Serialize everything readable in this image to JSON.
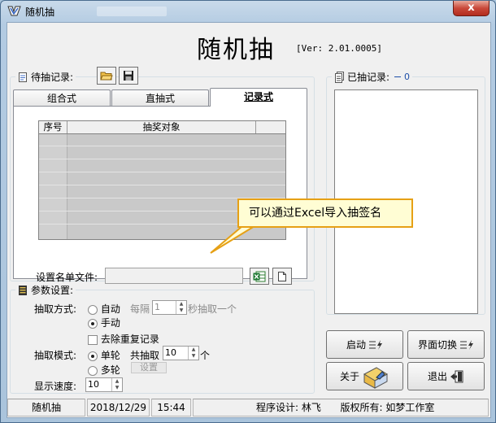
{
  "window": {
    "title": "随机抽",
    "close_glyph": "x"
  },
  "header": {
    "app_title": "随机抽",
    "version": "[Ver: 2.01.0005]"
  },
  "pending": {
    "legend": "待抽记录:",
    "tabs": [
      {
        "label": "组合式"
      },
      {
        "label": "直抽式"
      },
      {
        "label": "记录式"
      }
    ],
    "columns": [
      "序号",
      "抽奖对象"
    ],
    "file_label": "设置名单文件:",
    "file_value": ""
  },
  "drawn": {
    "legend": "已抽记录:",
    "count": "0"
  },
  "params": {
    "legend": "参数设置:",
    "method_label": "抽取方式:",
    "auto_label": "自动",
    "interval_prefix": "每隔",
    "interval_value": "1",
    "interval_suffix": "秒抽取一个",
    "manual_label": "手动",
    "dedupe_label": "去除重复记录",
    "mode_label": "抽取模式:",
    "single_label": "单轮",
    "total_prefix": "共抽取",
    "total_value": "10",
    "total_suffix": "个",
    "multi_label": "多轮",
    "setup_label": "设置",
    "speed_label": "显示速度:",
    "speed_value": "10"
  },
  "buttons": {
    "start": "启动",
    "switch": "界面切换",
    "about": "关于",
    "exit": "退出"
  },
  "status": {
    "app": "随机抽",
    "date": "2018/12/29",
    "time": "15:44",
    "designer": "程序设计: 林飞",
    "copyright": "版权所有: 如梦工作室"
  },
  "tooltip": {
    "text": "可以通过Excel导入抽签名"
  },
  "colors": {
    "tooltip_border": "#e6a015",
    "close_red": "#c9493a",
    "accent_blue": "#1e4fa8"
  },
  "icons": [
    "app-icon",
    "document-icon",
    "open-folder-icon",
    "save-disk-icon",
    "excel-icon",
    "new-file-icon",
    "list-icon",
    "settings-icon",
    "start-icon",
    "switch-icon",
    "about-icon",
    "exit-icon"
  ]
}
